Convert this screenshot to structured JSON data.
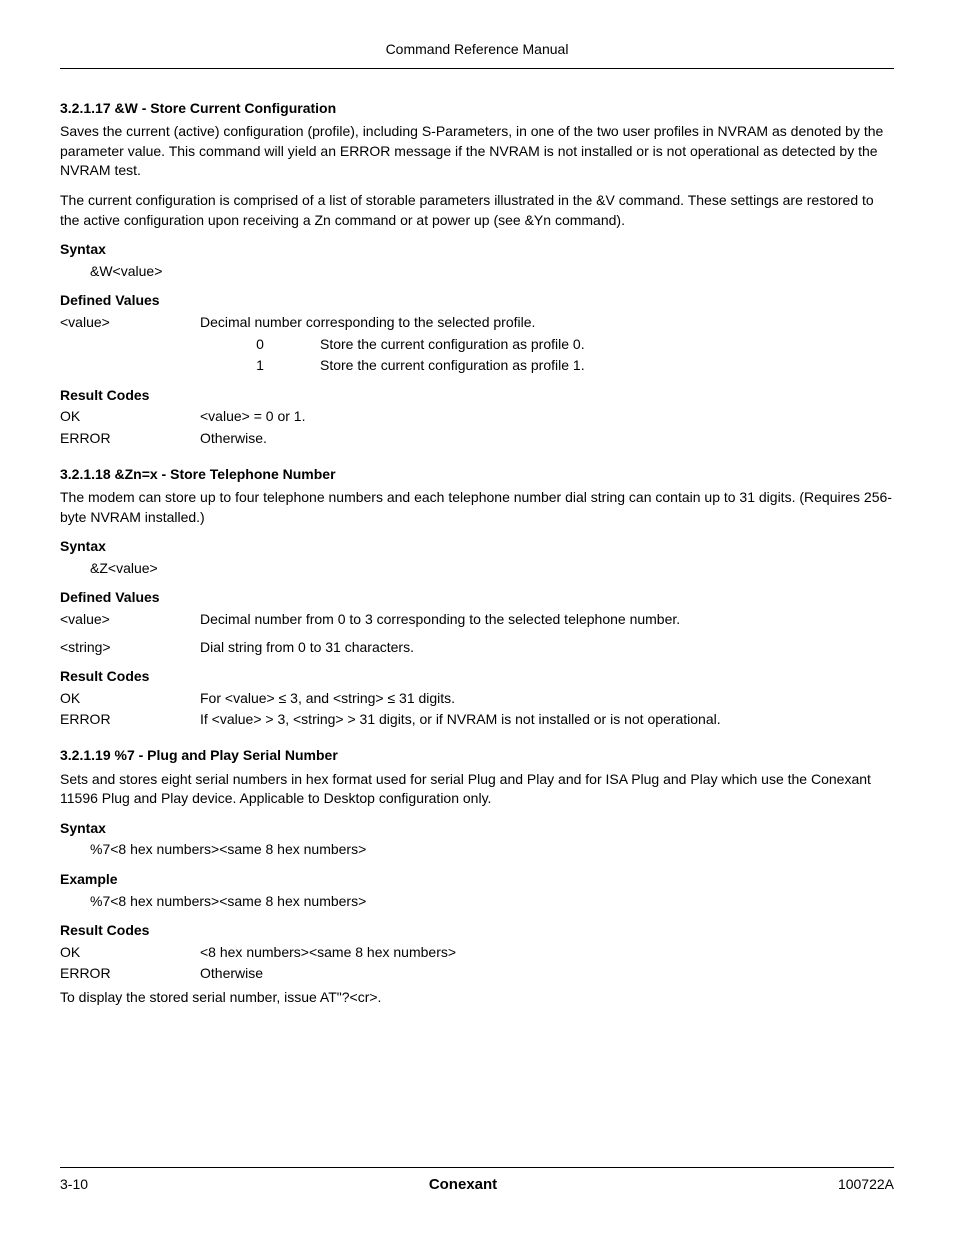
{
  "header": {
    "title": "Command Reference Manual"
  },
  "s1": {
    "title": "3.2.1.17  &W - Store Current Configuration",
    "p1": "Saves the current (active) configuration (profile), including S-Parameters, in one of the two user profiles in NVRAM as denoted by the parameter value. This command will yield an ERROR message if the NVRAM is not installed or is not operational as detected by the NVRAM test.",
    "p2": "The current configuration is comprised of a list of storable parameters illustrated in the &V command. These settings are restored to the active configuration upon receiving a Zn command or at power up (see &Yn command).",
    "syntax_h": "Syntax",
    "syntax_v": "&W<value>",
    "dv_h": "Defined Values",
    "dv_name": "<value>",
    "dv_desc": "Decimal number corresponding to the selected profile.",
    "opts": [
      {
        "k": "0",
        "v": "Store the current configuration as profile 0."
      },
      {
        "k": "1",
        "v": "Store the current configuration as profile 1."
      }
    ],
    "rc_h": "Result Codes",
    "rc": [
      {
        "k": "OK",
        "v": "<value> = 0 or 1."
      },
      {
        "k": "ERROR",
        "v": "Otherwise."
      }
    ]
  },
  "s2": {
    "title": "3.2.1.18  &Zn=x - Store Telephone Number",
    "p1": "The modem can store up to four telephone numbers and each telephone number dial string can contain up to 31 digits. (Requires 256-byte NVRAM installed.)",
    "syntax_h": "Syntax",
    "syntax_v": "&Z<value>",
    "dv_h": "Defined Values",
    "dv": [
      {
        "k": "<value>",
        "v": "Decimal number from 0 to 3 corresponding to the selected telephone number."
      },
      {
        "k": "<string>",
        "v": "Dial string from 0 to 31 characters."
      }
    ],
    "rc_h": "Result Codes",
    "rc": [
      {
        "k": "OK",
        "v": "For <value> ≤ 3, and <string> ≤ 31 digits."
      },
      {
        "k": "ERROR",
        "v": "If <value> > 3, <string> > 31 digits, or if NVRAM is not installed or is not operational."
      }
    ]
  },
  "s3": {
    "title": "3.2.1.19  %7 - Plug and Play Serial Number",
    "p1": "Sets and stores eight serial numbers in hex format used for serial Plug and Play and for ISA Plug and Play which use the Conexant 11596 Plug and Play device. Applicable to Desktop configuration only.",
    "syntax_h": "Syntax",
    "syntax_v": "%7<8 hex numbers><same 8 hex numbers>",
    "ex_h": "Example",
    "ex_v": "%7<8 hex numbers><same 8 hex numbers>",
    "rc_h": "Result Codes",
    "rc": [
      {
        "k": "OK",
        "v": "<8 hex numbers><same 8 hex numbers>"
      },
      {
        "k": "ERROR",
        "v": "Otherwise"
      }
    ],
    "note": "To display the stored serial number, issue AT\"?<cr>."
  },
  "footer": {
    "left": "3-10",
    "center": "Conexant",
    "right": "100722A"
  }
}
